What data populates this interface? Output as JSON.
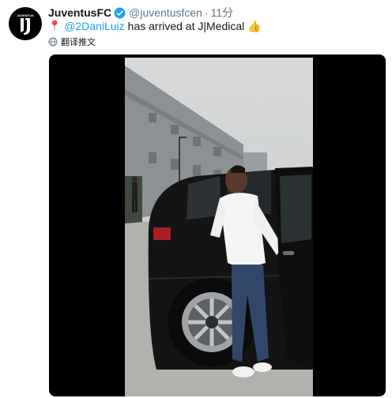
{
  "tweet": {
    "author_name": "JuventusFC",
    "handle": "@juventusfcen",
    "separator": "·",
    "time": "11分",
    "pin_emoji": "📍",
    "mention": "@2DaniLuiz",
    "text": "has arrived at J|Medical",
    "thumb_emoji": "👍",
    "translate_label": "翻译推文"
  },
  "colors": {
    "link": "#1da1f2",
    "muted": "#657786",
    "text": "#14171a"
  },
  "icons": {
    "avatar": "juventus-logo-icon",
    "verified": "verified-badge-icon",
    "translate": "globe-icon"
  }
}
